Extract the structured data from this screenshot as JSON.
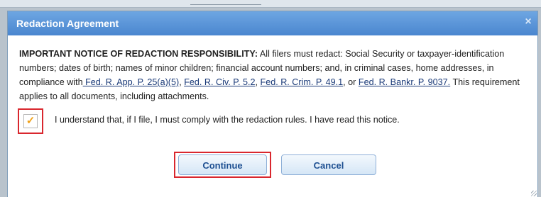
{
  "dialog": {
    "title": "Redaction Agreement",
    "close_icon": "×"
  },
  "notice": {
    "heading": "IMPORTANT NOTICE OF REDACTION RESPONSIBILITY:",
    "text_1": " All filers must redact: Social Security or taxpayer-identification numbers; dates of birth; names of minor children; financial account numbers; and, in criminal cases, home addresses, in compliance with",
    "link_1": " Fed. R. App. P. 25(a)(5)",
    "sep_1": ", ",
    "link_2": "Fed. R. Civ. P. 5.2",
    "sep_2": ", ",
    "link_3": "Fed. R. Crim. P. 49.1",
    "sep_3": ", or ",
    "link_4": "Fed. R. Bankr. P. 9037.",
    "text_2": " This requirement applies to all documents, including attachments."
  },
  "acknowledgement": {
    "checked": true,
    "check_glyph": "✓",
    "label": "I understand that, if I file, I must comply with the redaction rules. I have read this notice."
  },
  "buttons": {
    "continue": "Continue",
    "cancel": "Cancel"
  },
  "colors": {
    "titlebar": "#4a86cf",
    "highlight": "#d9272e",
    "checkmark": "#f0a21a",
    "link": "#1a3a78"
  }
}
